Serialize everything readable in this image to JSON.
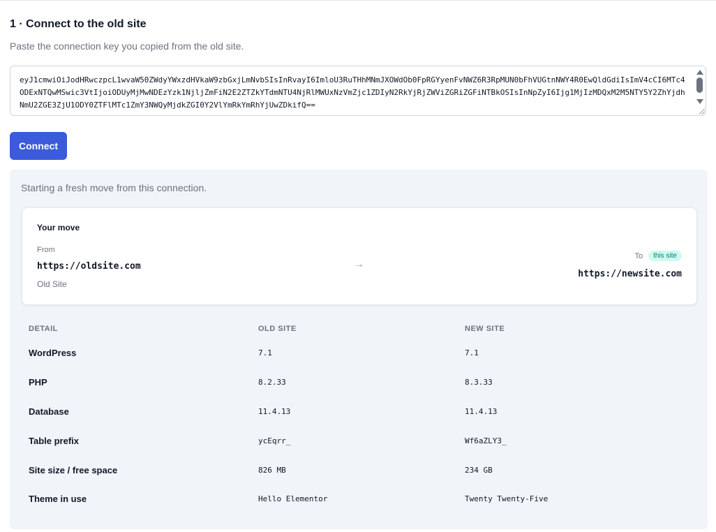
{
  "step": {
    "title": "1 · Connect to the old site",
    "subtitle": "Paste the connection key you copied from the old site."
  },
  "connection_key": "eyJ1cmwiOiJodHRwczpcL1wvaW50ZWdyYWxzdHVkaW9zbGxjLmNvbSIsInRvayI6ImloU3RuTHhMNmJXOWdOb0FpRGYyenFvNWZ6R3RpMUN0bFhVUGtnNWY4R0EwQldGdiIsImV4cCI6MTc4ODExNTQwMSwic3VtIjoiODUyMjMwNDEzYzk1NjljZmFiN2E2ZTZkYTdmNTU4NjRlMWUxNzVmZjc1ZDIyN2RkYjRjZWViZGRiZGFiNTBkOSIsInNpZyI6Ijg1MjIzMDQxM2M5NTY5Y2ZhYjdhNmU2ZGE3ZjU1ODY0ZTFlMTc1ZmY3NWQyMjdkZGI0Y2VlYmRkYmRhYjUwZDkifQ==",
  "connect_button": "Connect",
  "panel": {
    "note": "Starting a fresh move from this connection.",
    "move": {
      "title": "Your move",
      "from_label": "From",
      "from_url": "https://oldsite.com",
      "from_name": "Old Site",
      "arrow": "→",
      "to_label": "To",
      "to_badge": "this site",
      "to_url": "https://newsite.com"
    },
    "table": {
      "headers": [
        "DETAIL",
        "OLD SITE",
        "NEW SITE"
      ],
      "rows": [
        {
          "label": "WordPress",
          "old": "7.1",
          "new": "7.1"
        },
        {
          "label": "PHP",
          "old": "8.2.33",
          "new": "8.3.33"
        },
        {
          "label": "Database",
          "old": "11.4.13",
          "new": "11.4.13"
        },
        {
          "label": "Table prefix",
          "old": "ycEqrr_",
          "new": "Wf6aZLY3_"
        },
        {
          "label": "Site size / free space",
          "old": "826 MB",
          "new": "234 GB"
        },
        {
          "label": "Theme in use",
          "old": "Hello Elementor",
          "new": "Twenty Twenty-Five"
        }
      ]
    }
  },
  "colors": {
    "primary": "#3b5bdb",
    "panel_bg": "#f1f4f8",
    "badge_bg": "#ccfbf1",
    "badge_text": "#0f766e"
  }
}
